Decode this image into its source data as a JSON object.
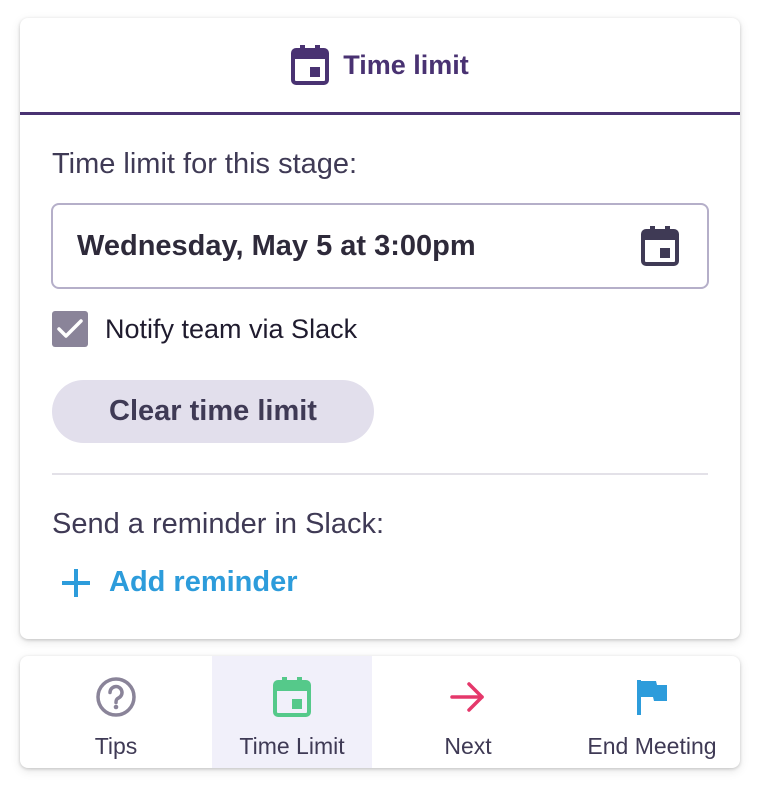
{
  "header": {
    "title": "Time limit",
    "icon": "calendar-icon",
    "color": "#493272"
  },
  "form": {
    "stage_label": "Time limit for this stage:",
    "date_value": "Wednesday, May 5 at 3:00pm",
    "notify_label": "Notify team via Slack",
    "notify_checked": true,
    "clear_button": "Clear time limit",
    "reminder_label": "Send a reminder in Slack:",
    "add_reminder": "Add reminder"
  },
  "colors": {
    "accent": "#493272",
    "link": "#2d9cdb",
    "green": "#55c98a",
    "red": "#e5386b",
    "blue": "#2d9cdb"
  },
  "bottom_bar": {
    "tabs": [
      {
        "label": "Tips",
        "icon": "question-circle-icon",
        "active": false
      },
      {
        "label": "Time Limit",
        "icon": "calendar-icon",
        "active": true
      },
      {
        "label": "Next",
        "icon": "arrow-right-icon",
        "active": false
      },
      {
        "label": "End Meeting",
        "icon": "flag-icon",
        "active": false
      }
    ]
  }
}
